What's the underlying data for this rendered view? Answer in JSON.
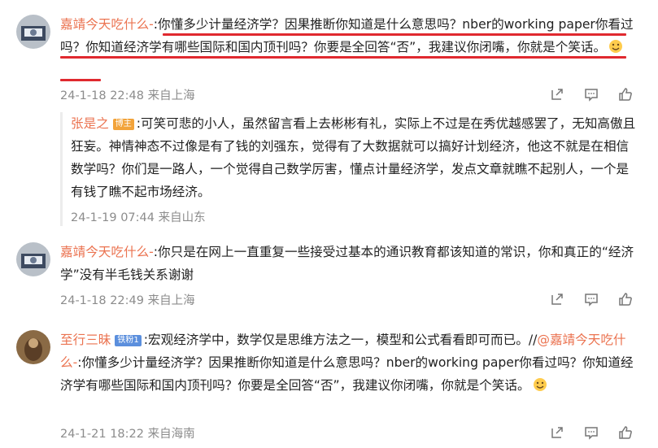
{
  "comments": [
    {
      "user": "嘉靖今天吃什么-",
      "text": ":你懂多少计量经济学？因果推断你知道是什么意思吗？nber的working paper你看过吗？你知道经济学有哪些国际和国内顶刊吗？你要是全回答“否”，我建议你闭嘴，你就是个笑话。",
      "meta": "24-1-18 22:48 来自上海",
      "reply": {
        "user": "张是之",
        "badge": "博主",
        "text": ":可笑可悲的小人，虽然留言看上去彬彬有礼，实际上不过是在秀优越感罢了，无知高傲且狂妄。神情神态不过像是有了钱的刘强东，觉得有了大数据就可以搞好计划经济，他这不就是在相信数学吗？你们是一路人，一个觉得自己数学厉害，懂点计量经济学，发点文章就瞧不起别人，一个是有钱了瞧不起市场经济。",
        "meta": "24-1-19 07:44 来自山东"
      }
    },
    {
      "user": "嘉靖今天吃什么-",
      "text": ":你只是在网上一直重复一些接受过基本的通识教育都该知道的常识，你和真正的“经济学”没有半毛钱关系谢谢",
      "meta": "24-1-18 22:49 来自上海"
    },
    {
      "user": "至行三昧",
      "badge": "铁粉1",
      "text": ":宏观经济学中，数学仅是思维方法之一，模型和公式看看即可而已。//",
      "mention": "@嘉靖今天吃什么-",
      "text2": ":你懂多少计量经济学？因果推断你知道是什么意思吗？nber的working paper你看过吗？你知道经济学有哪些国际和国内顶刊吗？你要是全回答“否”，我建议你闭嘴，你就是个笑话。",
      "meta": "24-1-21 18:22 来自海南"
    }
  ],
  "colors": {
    "username": "#eb7350",
    "meta": "#8c8c8c",
    "underline": "#e0292f"
  },
  "icons": [
    "share-icon",
    "comment-icon",
    "like-icon",
    "emoji-icon"
  ]
}
